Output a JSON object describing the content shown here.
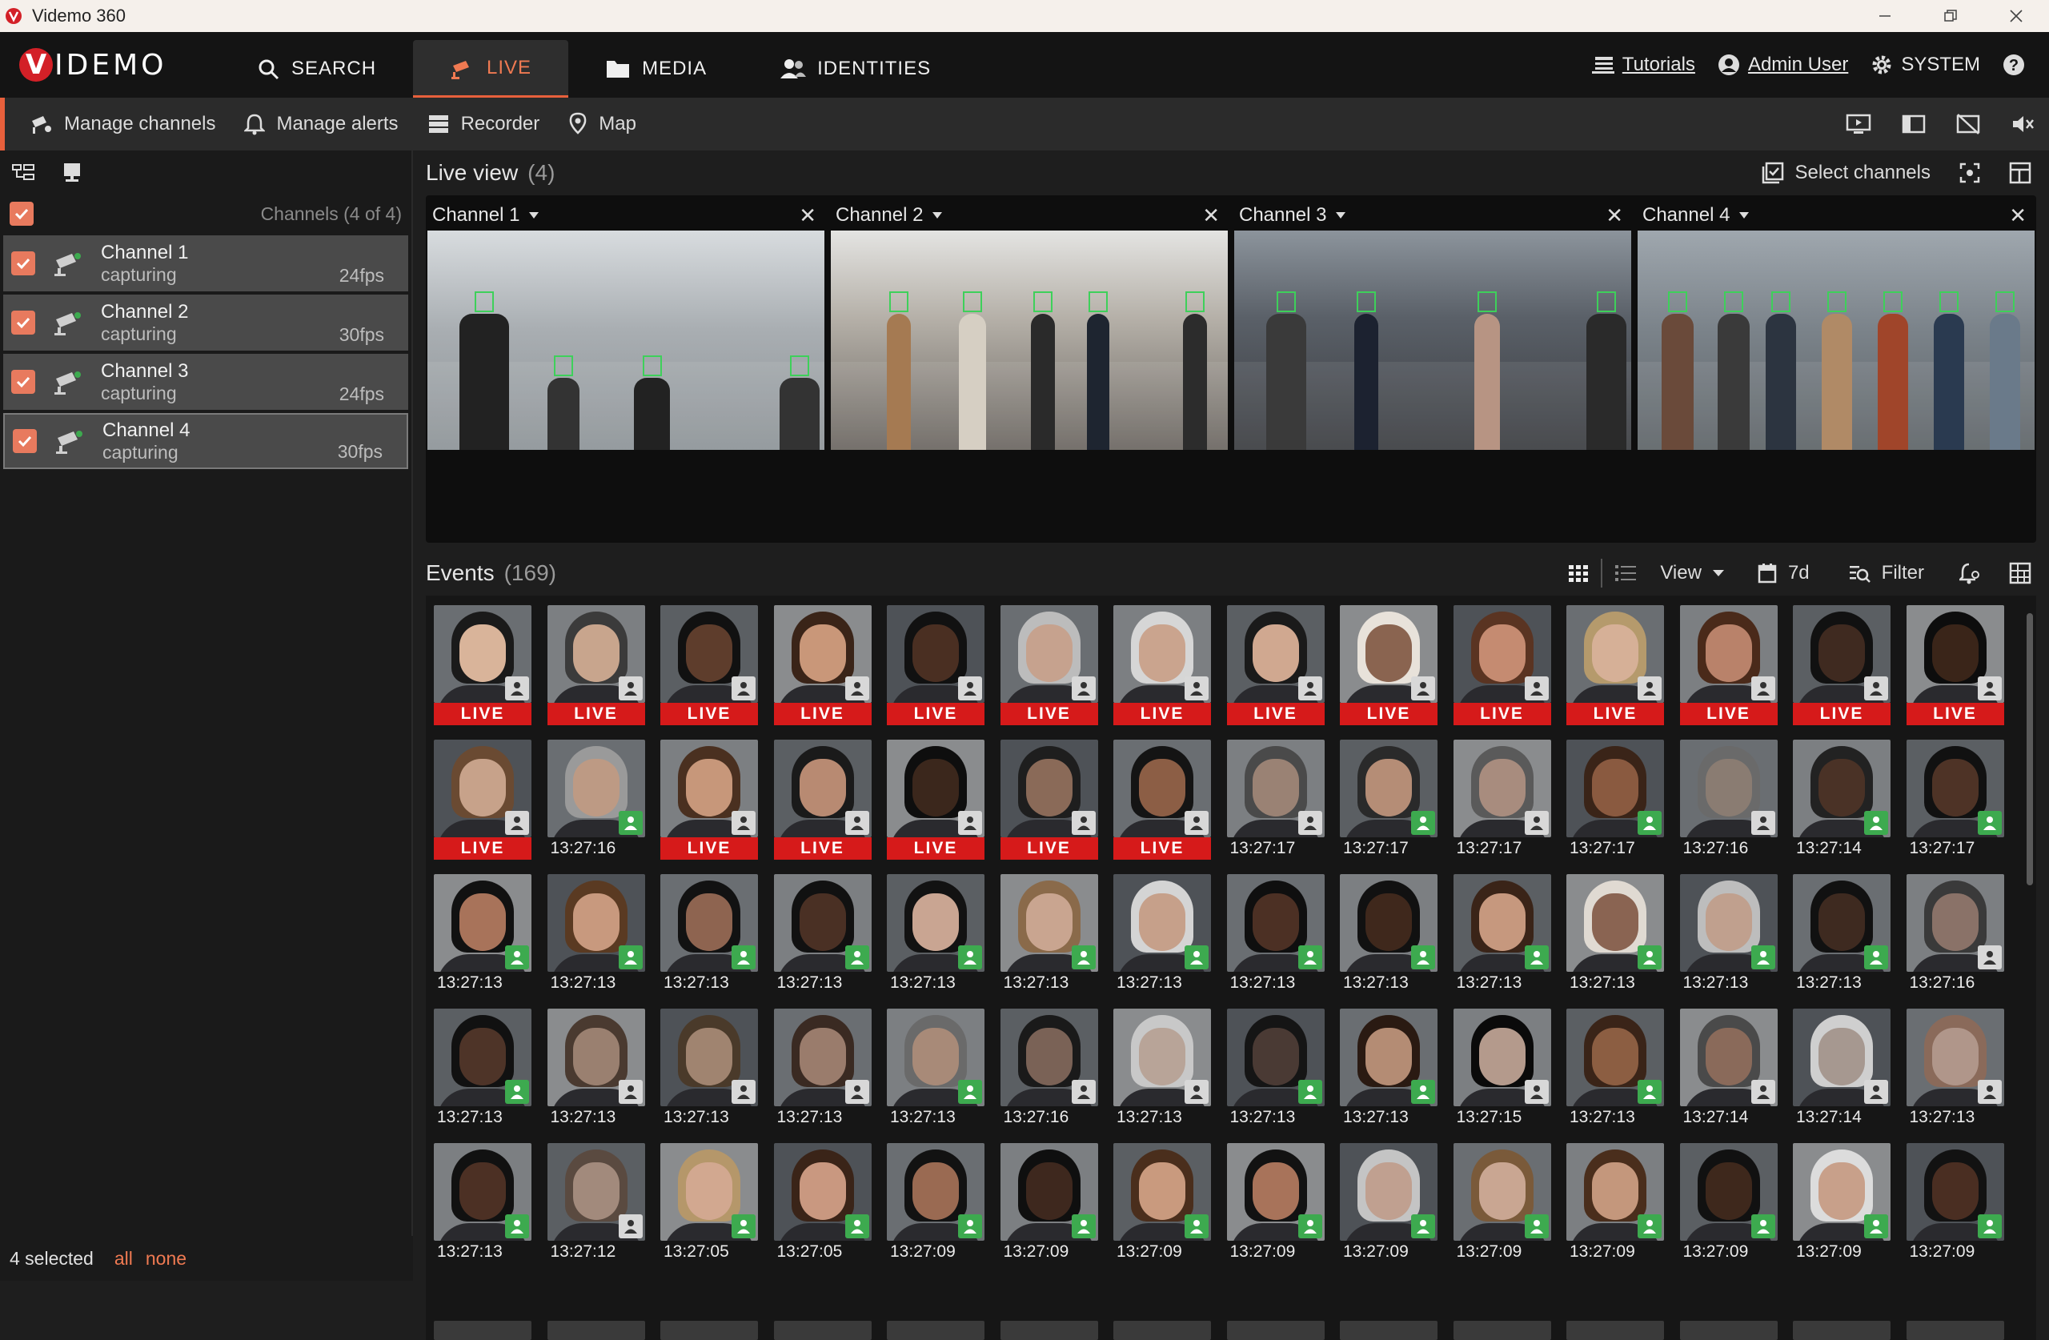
{
  "window": {
    "title": "Videmo 360"
  },
  "brand": {
    "mark": "V",
    "word": "IDEMO"
  },
  "nav": {
    "tabs": [
      {
        "label": "SEARCH"
      },
      {
        "label": "LIVE"
      },
      {
        "label": "MEDIA"
      },
      {
        "label": "IDENTITIES"
      }
    ],
    "active": "LIVE",
    "tutorials": "Tutorials",
    "user": "Admin User",
    "system": "SYSTEM"
  },
  "toolbar": {
    "manage_channels": "Manage channels",
    "manage_alerts": "Manage alerts",
    "recorder": "Recorder",
    "map": "Map"
  },
  "sidebar": {
    "channels_count": "Channels (4 of 4)",
    "channels": [
      {
        "name": "Channel 1",
        "status": "capturing",
        "fps": "24fps"
      },
      {
        "name": "Channel 2",
        "status": "capturing",
        "fps": "30fps"
      },
      {
        "name": "Channel 3",
        "status": "capturing",
        "fps": "24fps"
      },
      {
        "name": "Channel 4",
        "status": "capturing",
        "fps": "30fps"
      }
    ],
    "footer": {
      "selected": "4 selected",
      "all": "all",
      "none": "none"
    }
  },
  "liveview": {
    "title": "Live view",
    "count": "(4)",
    "select_channels": "Select channels",
    "cells": [
      {
        "label": "Channel 1"
      },
      {
        "label": "Channel 2"
      },
      {
        "label": "Channel 3"
      },
      {
        "label": "Channel 4"
      }
    ]
  },
  "events": {
    "title": "Events",
    "count": "(169)",
    "view": "View",
    "range": "7d",
    "filter": "Filter",
    "items": [
      {
        "label": "LIVE",
        "live": true,
        "badge": "grey",
        "skin": "#d9b49a",
        "hair": "#1a1a1a"
      },
      {
        "label": "LIVE",
        "live": true,
        "badge": "grey",
        "skin": "#c8a58d",
        "hair": "#3b3b3b"
      },
      {
        "label": "LIVE",
        "live": true,
        "badge": "grey",
        "skin": "#5e3d2c",
        "hair": "#111"
      },
      {
        "label": "LIVE",
        "live": true,
        "badge": "grey",
        "skin": "#c99779",
        "hair": "#3a2418"
      },
      {
        "label": "LIVE",
        "live": true,
        "badge": "grey",
        "skin": "#4a2f22",
        "hair": "#111"
      },
      {
        "label": "LIVE",
        "live": true,
        "badge": "grey",
        "skin": "#c6a28e",
        "hair": "#bcbcbc"
      },
      {
        "label": "LIVE",
        "live": true,
        "badge": "grey",
        "skin": "#caa48e",
        "hair": "#d6d6d6"
      },
      {
        "label": "LIVE",
        "live": true,
        "badge": "grey",
        "skin": "#d0a890",
        "hair": "#1a1a1a"
      },
      {
        "label": "LIVE",
        "live": true,
        "badge": "grey",
        "skin": "#8a6450",
        "hair": "#e8e2da"
      },
      {
        "label": "LIVE",
        "live": true,
        "badge": "grey",
        "skin": "#c58b71",
        "hair": "#5a3422"
      },
      {
        "label": "LIVE",
        "live": true,
        "badge": "grey",
        "skin": "#d6b097",
        "hair": "#b59a6c"
      },
      {
        "label": "LIVE",
        "live": true,
        "badge": "grey",
        "skin": "#b9826a",
        "hair": "#4a2a1a"
      },
      {
        "label": "LIVE",
        "live": true,
        "badge": "grey",
        "skin": "#3f2a20",
        "hair": "#111"
      },
      {
        "label": "LIVE",
        "live": true,
        "badge": "grey",
        "skin": "#3a2519",
        "hair": "#0d0d0d"
      },
      {
        "label": "LIVE",
        "live": true,
        "badge": "grey",
        "skin": "#c7a28a",
        "hair": "#6a4a32"
      },
      {
        "label": "13:27:16",
        "live": false,
        "badge": "green",
        "skin": "#bd9a84",
        "hair": "#9a9a9a"
      },
      {
        "label": "LIVE",
        "live": true,
        "badge": "grey",
        "skin": "#c7977a",
        "hair": "#4a3020"
      },
      {
        "label": "LIVE",
        "live": true,
        "badge": "grey",
        "skin": "#b88a72",
        "hair": "#1a1a1a"
      },
      {
        "label": "LIVE",
        "live": true,
        "badge": "grey",
        "skin": "#3b271c",
        "hair": "#0e0e0e"
      },
      {
        "label": "LIVE",
        "live": true,
        "badge": "grey",
        "skin": "#8a6a58",
        "hair": "#1e1e1e"
      },
      {
        "label": "LIVE",
        "live": true,
        "badge": "grey",
        "skin": "#8c5e45",
        "hair": "#141414"
      },
      {
        "label": "13:27:17",
        "live": false,
        "badge": "grey",
        "skin": "#9a8274",
        "hair": "#4a4a4a"
      },
      {
        "label": "13:27:17",
        "live": false,
        "badge": "green",
        "skin": "#b58d76",
        "hair": "#2a2a2a"
      },
      {
        "label": "13:27:17",
        "live": false,
        "badge": "grey",
        "skin": "#a88c7e",
        "hair": "#5a5a5a"
      },
      {
        "label": "13:27:17",
        "live": false,
        "badge": "green",
        "skin": "#8a5a40",
        "hair": "#3a2418"
      },
      {
        "label": "13:27:16",
        "live": false,
        "badge": "grey",
        "skin": "#8a7c72",
        "hair": "#6a6a6a"
      },
      {
        "label": "13:27:14",
        "live": false,
        "badge": "green",
        "skin": "#4a3226",
        "hair": "#222"
      },
      {
        "label": "13:27:17",
        "live": false,
        "badge": "green",
        "skin": "#4e3326",
        "hair": "#111"
      },
      {
        "label": "13:27:13",
        "live": false,
        "badge": "green",
        "skin": "#a8735a",
        "hair": "#111"
      },
      {
        "label": "13:27:13",
        "live": false,
        "badge": "green",
        "skin": "#c8997e",
        "hair": "#5a3a22"
      },
      {
        "label": "13:27:13",
        "live": false,
        "badge": "green",
        "skin": "#8e6450",
        "hair": "#121212"
      },
      {
        "label": "13:27:13",
        "live": false,
        "badge": "green",
        "skin": "#4a3024",
        "hair": "#111"
      },
      {
        "label": "13:27:13",
        "live": false,
        "badge": "green",
        "skin": "#c9a592",
        "hair": "#121212"
      },
      {
        "label": "13:27:13",
        "live": false,
        "badge": "green",
        "skin": "#c9a590",
        "hair": "#8a6a4a"
      },
      {
        "label": "13:27:13",
        "live": false,
        "badge": "green",
        "skin": "#c6a08a",
        "hair": "#d4d4d4"
      },
      {
        "label": "13:27:13",
        "live": false,
        "badge": "green",
        "skin": "#4c3024",
        "hair": "#0f0f0f"
      },
      {
        "label": "13:27:13",
        "live": false,
        "badge": "green",
        "skin": "#3f281c",
        "hair": "#111"
      },
      {
        "label": "13:27:13",
        "live": false,
        "badge": "green",
        "skin": "#c6987e",
        "hair": "#3a2418"
      },
      {
        "label": "13:27:13",
        "live": false,
        "badge": "green",
        "skin": "#8a6452",
        "hair": "#e0dad2"
      },
      {
        "label": "13:27:13",
        "live": false,
        "badge": "green",
        "skin": "#c0a08e",
        "hair": "#bdbdbd"
      },
      {
        "label": "13:27:13",
        "live": false,
        "badge": "green",
        "skin": "#3e2a20",
        "hair": "#111"
      },
      {
        "label": "13:27:16",
        "live": false,
        "badge": "grey",
        "skin": "#8a7268",
        "hair": "#3a3a3a"
      },
      {
        "label": "13:27:13",
        "live": false,
        "badge": "green",
        "skin": "#4e3428",
        "hair": "#111"
      },
      {
        "label": "13:27:13",
        "live": false,
        "badge": "grey",
        "skin": "#9a8070",
        "hair": "#4a3a30"
      },
      {
        "label": "13:27:13",
        "live": false,
        "badge": "grey",
        "skin": "#a08470",
        "hair": "#4a3a2a"
      },
      {
        "label": "13:27:13",
        "live": false,
        "badge": "grey",
        "skin": "#9a7c6c",
        "hair": "#3a2a22"
      },
      {
        "label": "13:27:13",
        "live": false,
        "badge": "green",
        "skin": "#a88a78",
        "hair": "#6a6a6a"
      },
      {
        "label": "13:27:16",
        "live": false,
        "badge": "grey",
        "skin": "#7a6256",
        "hair": "#1a1a1a"
      },
      {
        "label": "13:27:13",
        "live": false,
        "badge": "grey",
        "skin": "#b8a498",
        "hair": "#c8c8c8"
      },
      {
        "label": "13:27:13",
        "live": false,
        "badge": "green",
        "skin": "#4a3a34",
        "hair": "#151515"
      },
      {
        "label": "13:27:13",
        "live": false,
        "badge": "green",
        "skin": "#b48c74",
        "hair": "#2a1a12"
      },
      {
        "label": "13:27:15",
        "live": false,
        "badge": "grey",
        "skin": "#b49a8c",
        "hair": "#0a0a0a"
      },
      {
        "label": "13:27:13",
        "live": false,
        "badge": "green",
        "skin": "#8c5e42",
        "hair": "#3a2418"
      },
      {
        "label": "13:27:14",
        "live": false,
        "badge": "grey",
        "skin": "#8a6a5a",
        "hair": "#4a4a4a"
      },
      {
        "label": "13:27:14",
        "live": false,
        "badge": "grey",
        "skin": "#a69890",
        "hair": "#cfcfcf"
      },
      {
        "label": "13:27:13",
        "live": false,
        "badge": "grey",
        "skin": "#b0968a",
        "hair": "#8a6a5a"
      },
      {
        "label": "13:27:13",
        "live": false,
        "badge": "green",
        "skin": "#4c3024",
        "hair": "#111"
      },
      {
        "label": "13:27:12",
        "live": false,
        "badge": "grey",
        "skin": "#a28a7c",
        "hair": "#5a4a40"
      },
      {
        "label": "13:27:05",
        "live": false,
        "badge": "green",
        "skin": "#d2a890",
        "hair": "#b5976a"
      },
      {
        "label": "13:27:05",
        "live": false,
        "badge": "green",
        "skin": "#c99880",
        "hair": "#3a2418"
      },
      {
        "label": "13:27:09",
        "live": false,
        "badge": "green",
        "skin": "#9a6a52",
        "hair": "#121212"
      },
      {
        "label": "13:27:09",
        "live": false,
        "badge": "green",
        "skin": "#3e281e",
        "hair": "#0f0f0f"
      },
      {
        "label": "13:27:09",
        "live": false,
        "badge": "green",
        "skin": "#c99a7e",
        "hair": "#4a2e1c"
      },
      {
        "label": "13:27:09",
        "live": false,
        "badge": "green",
        "skin": "#a8735a",
        "hair": "#121212"
      },
      {
        "label": "13:27:09",
        "live": false,
        "badge": "green",
        "skin": "#c0a090",
        "hair": "#c4c4c4"
      },
      {
        "label": "13:27:09",
        "live": false,
        "badge": "green",
        "skin": "#c9a692",
        "hair": "#7a5a3a"
      },
      {
        "label": "13:27:09",
        "live": false,
        "badge": "green",
        "skin": "#c4977c",
        "hair": "#4a2e1c"
      },
      {
        "label": "13:27:09",
        "live": false,
        "badge": "green",
        "skin": "#3e281c",
        "hair": "#111"
      },
      {
        "label": "13:27:09",
        "live": false,
        "badge": "green",
        "skin": "#c8a08a",
        "hair": "#dcdcdc"
      },
      {
        "label": "13:27:09",
        "live": false,
        "badge": "green",
        "skin": "#4a2e22",
        "hair": "#121212"
      }
    ]
  },
  "colors": {
    "accent": "#e8603c",
    "live": "#d61a1a",
    "known": "#3daa4f",
    "brand": "#d32027"
  }
}
